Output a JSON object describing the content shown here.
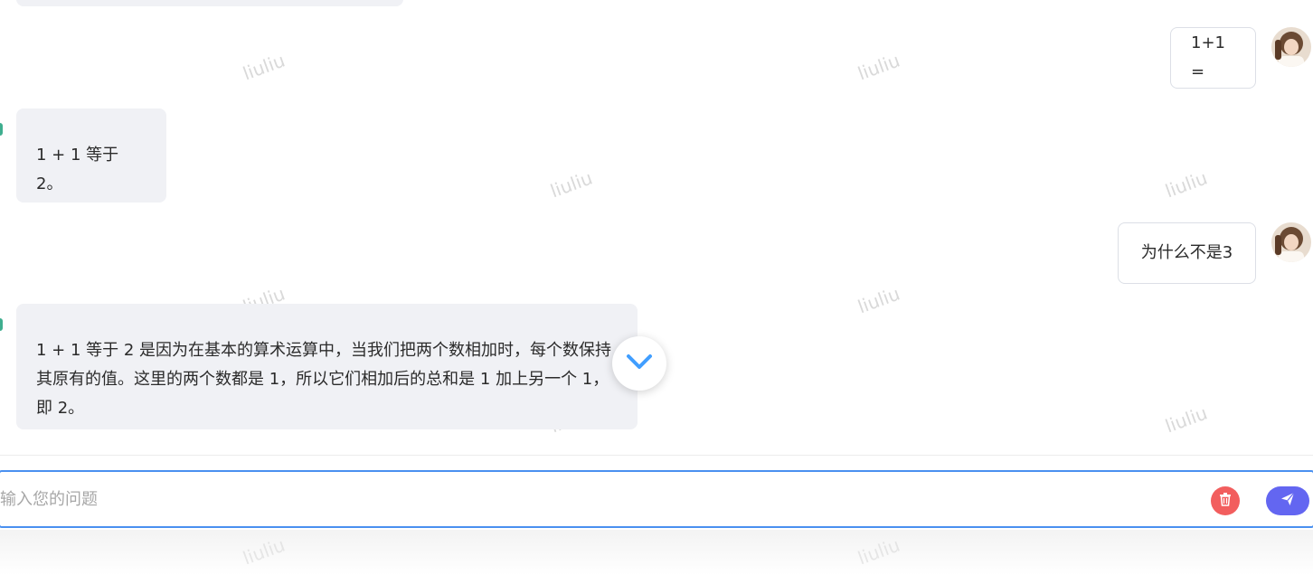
{
  "watermark_text": "liuliu",
  "messages": [
    {
      "role": "user",
      "text": "1+1 ="
    },
    {
      "role": "assistant",
      "text": "1 + 1 等于 2。"
    },
    {
      "role": "user",
      "text": "为什么不是3"
    },
    {
      "role": "assistant",
      "text": "1 + 1 等于 2 是因为在基本的算术运算中，当我们把两个数相加时，每个数保持其原有的值。这里的两个数都是 1，所以它们相加后的总和是 1 加上另一个 1，即 2。"
    }
  ],
  "input": {
    "placeholder": "输入您的问题",
    "value": ""
  },
  "icons": {
    "scroll": "chevron-down-icon",
    "delete": "trash-icon",
    "send": "paper-plane-icon"
  },
  "colors": {
    "input_border": "#4a90f0",
    "delete_button": "#f25e5e",
    "send_button": "#6366f1",
    "scroll_chevron": "#409eff"
  }
}
